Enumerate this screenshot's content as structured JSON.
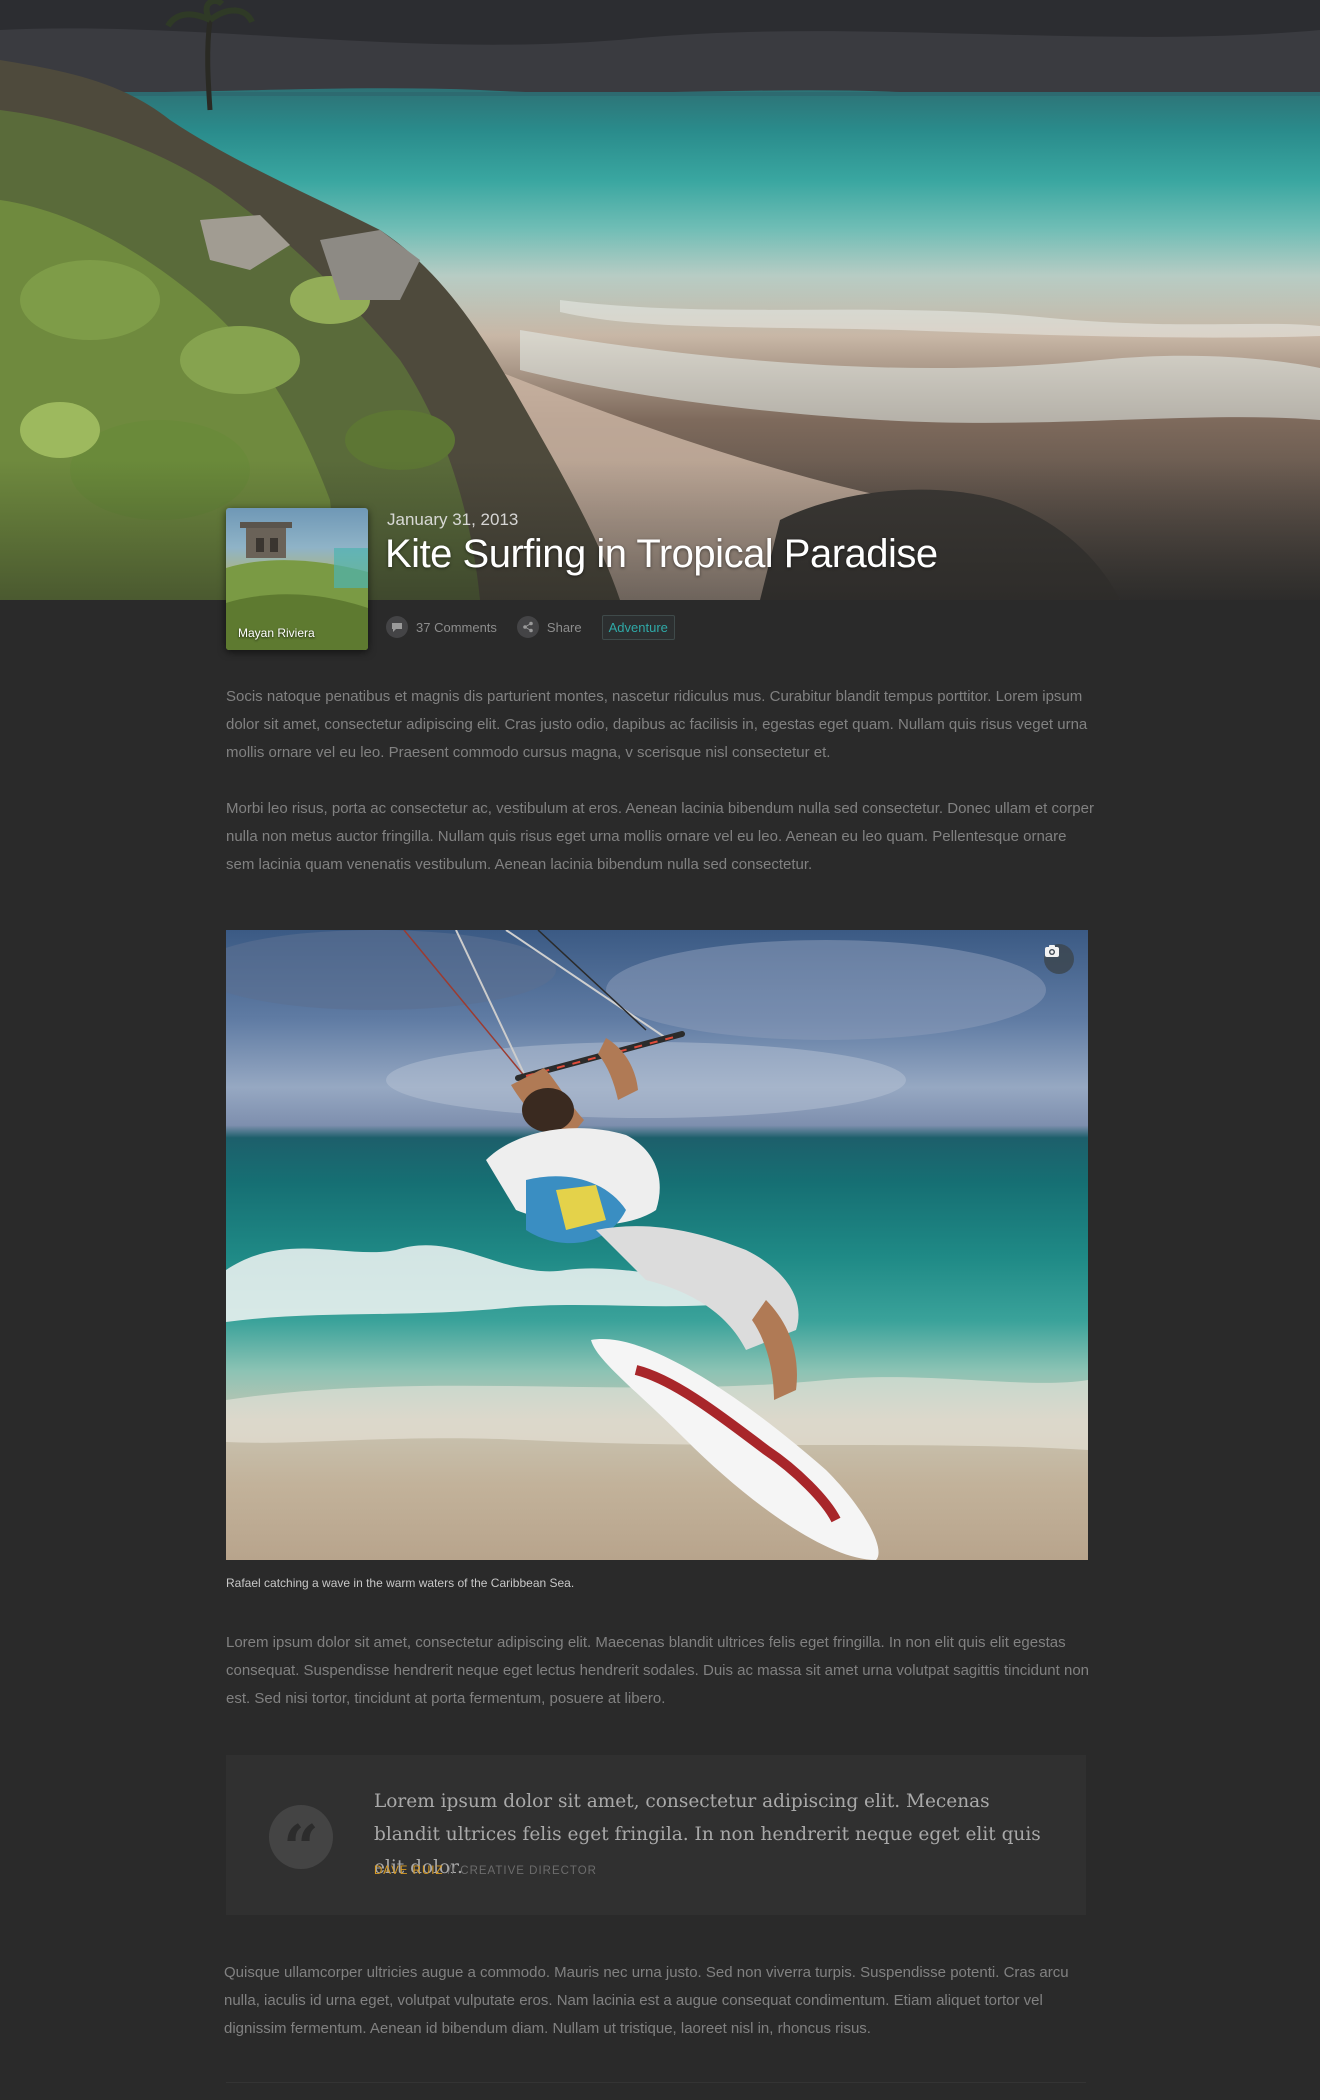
{
  "post": {
    "thumbnail_label": "Mayan Riviera",
    "date": "January 31, 2013",
    "title": "Kite Surfing in Tropical Paradise",
    "meta": {
      "comments": "37 Comments",
      "share": "Share",
      "tag": "Adventure"
    }
  },
  "body": {
    "paragraphs_intro": [
      "Socis natoque penatibus et magnis dis parturient montes, nascetur ridiculus mus. Curabitur blandit tempus porttitor. Lorem ipsum dolor sit amet, consectetur adipiscing elit. Cras justo odio, dapibus ac facilisis in, egestas eget quam. Nullam quis risus veget urna mollis ornare vel eu leo. Praesent commodo cursus magna, v scerisque nisl consectetur et.",
      "Morbi leo risus, porta ac consectetur ac, vestibulum at eros. Aenean lacinia bibendum nulla sed consectetur. Donec ullam et corper nulla non metus auctor fringilla. Nullam quis risus eget urna mollis ornare vel eu leo. Aenean eu leo quam. Pellentesque ornare sem lacinia quam venenatis vestibulum. Aenean lacinia bibendum nulla sed consectetur."
    ],
    "photo_caption": "Rafael catching a wave in the warm waters of the Caribbean Sea.",
    "paragraph_after_photo": "Lorem ipsum dolor sit amet, consectetur adipiscing elit. Maecenas blandit ultrices felis eget fringilla. In non elit quis elit egestas consequat. Suspendisse hendrerit neque eget lectus hendrerit sodales. Duis ac massa sit amet urna volutpat sagittis tincidunt non est. Sed nisi tortor, tincidunt at porta fermentum, posuere at libero.",
    "quote": {
      "mark": "“",
      "text": "Lorem ipsum dolor sit amet, consectetur adipiscing elit. Mecenas blandit ultrices felis eget fringila. In non hendrerit neque eget elit quis elit dolor.",
      "author": "DAVE RUIZ",
      "separator": " // ",
      "role": "CREATIVE DIRECTOR"
    },
    "paragraph_final": "Quisque ullamcorper ultricies augue a commodo. Mauris nec urna justo. Sed non viverra turpis. Suspendisse potenti. Cras arcu nulla, iaculis id urna eget, volutpat vulputate eros. Nam lacinia est a augue consequat condimentum. Etiam aliquet tortor vel dignissim fermentum. Aenean id bibendum diam. Nullam ut tristique, laoreet nisl in, rhoncus risus."
  },
  "icons": {
    "comments": "speech-bubble-icon",
    "share": "share-icon",
    "photo": "camera-icon",
    "quote": "quote-mark-icon"
  },
  "colors": {
    "page_background": "#2a2a2a",
    "tag_accent": "#2fa9a7",
    "quote_author": "#d79a24"
  }
}
